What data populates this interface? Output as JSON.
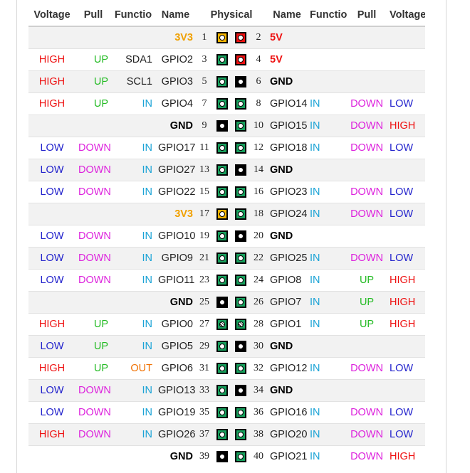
{
  "colors": {
    "high": "#ee1111",
    "low": "#2222cc",
    "up": "#22bb22",
    "down": "#dd22dd",
    "in": "#1aa3d6",
    "out": "#f07000",
    "v33": "#f0a000",
    "v5": "#ee1111",
    "gnd": "#000000",
    "text": "#222222",
    "pin_gpio": "#17a05d",
    "pin_gnd": "#000000",
    "pin_3v3": "#f4b400",
    "pin_5v": "#ee1111"
  },
  "headers": {
    "voltage": "Voltage",
    "pull": "Pull",
    "function": "Functio",
    "name": "Name",
    "physical": "Physical"
  },
  "rows": [
    {
      "lv": "",
      "lp": "",
      "lf": "",
      "ln": "3V3",
      "lnk": "v33",
      "p1": "1",
      "p1k": "pin_3v3",
      "p2": "2",
      "p2k": "pin_5v",
      "rn": "5V",
      "rnk": "v5",
      "rf": "",
      "rp": "",
      "rv": ""
    },
    {
      "lv": "HIGH",
      "lp": "UP",
      "lf": "SDA1",
      "lfk": "text",
      "ln": "GPIO2",
      "lnk": "text",
      "p1": "3",
      "p1k": "pin_gpio",
      "p2": "4",
      "p2k": "pin_5v",
      "rn": "5V",
      "rnk": "v5",
      "rf": "",
      "rp": "",
      "rv": ""
    },
    {
      "lv": "HIGH",
      "lp": "UP",
      "lf": "SCL1",
      "lfk": "text",
      "ln": "GPIO3",
      "lnk": "text",
      "p1": "5",
      "p1k": "pin_gpio",
      "p2": "6",
      "p2k": "pin_gnd",
      "rn": "GND",
      "rnk": "gnd",
      "rf": "",
      "rp": "",
      "rv": ""
    },
    {
      "lv": "HIGH",
      "lp": "UP",
      "lf": "IN",
      "ln": "GPIO4",
      "lnk": "text",
      "p1": "7",
      "p1k": "pin_gpio",
      "p2": "8",
      "p2k": "pin_gpio",
      "rn": "GPIO14",
      "rnk": "text",
      "rf": "IN",
      "rp": "DOWN",
      "rv": "LOW"
    },
    {
      "lv": "",
      "lp": "",
      "lf": "",
      "ln": "GND",
      "lnk": "gnd",
      "p1": "9",
      "p1k": "pin_gnd",
      "p2": "10",
      "p2k": "pin_gpio",
      "rn": "GPIO15",
      "rnk": "text",
      "rf": "IN",
      "rp": "DOWN",
      "rv": "HIGH"
    },
    {
      "lv": "LOW",
      "lp": "DOWN",
      "lf": "IN",
      "ln": "GPIO17",
      "lnk": "text",
      "p1": "11",
      "p1k": "pin_gpio",
      "p2": "12",
      "p2k": "pin_gpio",
      "rn": "GPIO18",
      "rnk": "text",
      "rf": "IN",
      "rp": "DOWN",
      "rv": "LOW"
    },
    {
      "lv": "LOW",
      "lp": "DOWN",
      "lf": "IN",
      "ln": "GPIO27",
      "lnk": "text",
      "p1": "13",
      "p1k": "pin_gpio",
      "p2": "14",
      "p2k": "pin_gnd",
      "rn": "GND",
      "rnk": "gnd",
      "rf": "",
      "rp": "",
      "rv": ""
    },
    {
      "lv": "LOW",
      "lp": "DOWN",
      "lf": "IN",
      "ln": "GPIO22",
      "lnk": "text",
      "p1": "15",
      "p1k": "pin_gpio",
      "p2": "16",
      "p2k": "pin_gpio",
      "rn": "GPIO23",
      "rnk": "text",
      "rf": "IN",
      "rp": "DOWN",
      "rv": "LOW"
    },
    {
      "lv": "",
      "lp": "",
      "lf": "",
      "ln": "3V3",
      "lnk": "v33",
      "p1": "17",
      "p1k": "pin_3v3",
      "p2": "18",
      "p2k": "pin_gpio",
      "rn": "GPIO24",
      "rnk": "text",
      "rf": "IN",
      "rp": "DOWN",
      "rv": "LOW"
    },
    {
      "lv": "LOW",
      "lp": "DOWN",
      "lf": "IN",
      "ln": "GPIO10",
      "lnk": "text",
      "p1": "19",
      "p1k": "pin_gpio",
      "p2": "20",
      "p2k": "pin_gnd",
      "rn": "GND",
      "rnk": "gnd",
      "rf": "",
      "rp": "",
      "rv": ""
    },
    {
      "lv": "LOW",
      "lp": "DOWN",
      "lf": "IN",
      "ln": "GPIO9",
      "lnk": "text",
      "p1": "21",
      "p1k": "pin_gpio",
      "p2": "22",
      "p2k": "pin_gpio",
      "rn": "GPIO25",
      "rnk": "text",
      "rf": "IN",
      "rp": "DOWN",
      "rv": "LOW"
    },
    {
      "lv": "LOW",
      "lp": "DOWN",
      "lf": "IN",
      "ln": "GPIO11",
      "lnk": "text",
      "p1": "23",
      "p1k": "pin_gpio",
      "p2": "24",
      "p2k": "pin_gpio",
      "rn": "GPIO8",
      "rnk": "text",
      "rf": "IN",
      "rp": "UP",
      "rv": "HIGH"
    },
    {
      "lv": "",
      "lp": "",
      "lf": "",
      "ln": "GND",
      "lnk": "gnd",
      "p1": "25",
      "p1k": "pin_gnd",
      "p2": "26",
      "p2k": "pin_gpio",
      "rn": "GPIO7",
      "rnk": "text",
      "rf": "IN",
      "rp": "UP",
      "rv": "HIGH"
    },
    {
      "lv": "HIGH",
      "lp": "UP",
      "lf": "IN",
      "ln": "GPIO0",
      "lnk": "text",
      "p1": "27",
      "p1k": "pin_uart",
      "p2": "28",
      "p2k": "pin_uart",
      "rn": "GPIO1",
      "rnk": "text",
      "rf": "IN",
      "rp": "UP",
      "rv": "HIGH"
    },
    {
      "lv": "LOW",
      "lp": "UP",
      "lf": "IN",
      "ln": "GPIO5",
      "lnk": "text",
      "p1": "29",
      "p1k": "pin_gpio",
      "p2": "30",
      "p2k": "pin_gnd",
      "rn": "GND",
      "rnk": "gnd",
      "rf": "",
      "rp": "",
      "rv": ""
    },
    {
      "lv": "HIGH",
      "lp": "UP",
      "lf": "OUT",
      "ln": "GPIO6",
      "lnk": "text",
      "p1": "31",
      "p1k": "pin_gpio",
      "p2": "32",
      "p2k": "pin_gpio",
      "rn": "GPIO12",
      "rnk": "text",
      "rf": "IN",
      "rp": "DOWN",
      "rv": "LOW"
    },
    {
      "lv": "LOW",
      "lp": "DOWN",
      "lf": "IN",
      "ln": "GPIO13",
      "lnk": "text",
      "p1": "33",
      "p1k": "pin_gpio",
      "p2": "34",
      "p2k": "pin_gnd",
      "rn": "GND",
      "rnk": "gnd",
      "rf": "",
      "rp": "",
      "rv": ""
    },
    {
      "lv": "LOW",
      "lp": "DOWN",
      "lf": "IN",
      "ln": "GPIO19",
      "lnk": "text",
      "p1": "35",
      "p1k": "pin_gpio",
      "p2": "36",
      "p2k": "pin_gpio",
      "rn": "GPIO16",
      "rnk": "text",
      "rf": "IN",
      "rp": "DOWN",
      "rv": "LOW"
    },
    {
      "lv": "HIGH",
      "lp": "DOWN",
      "lf": "IN",
      "ln": "GPIO26",
      "lnk": "text",
      "p1": "37",
      "p1k": "pin_gpio",
      "p2": "38",
      "p2k": "pin_gpio",
      "rn": "GPIO20",
      "rnk": "text",
      "rf": "IN",
      "rp": "DOWN",
      "rv": "LOW"
    },
    {
      "lv": "",
      "lp": "",
      "lf": "",
      "ln": "GND",
      "lnk": "gnd",
      "p1": "39",
      "p1k": "pin_gnd",
      "p2": "40",
      "p2k": "pin_gpio",
      "rn": "GPIO21",
      "rnk": "text",
      "rf": "IN",
      "rp": "DOWN",
      "rv": "HIGH"
    }
  ]
}
